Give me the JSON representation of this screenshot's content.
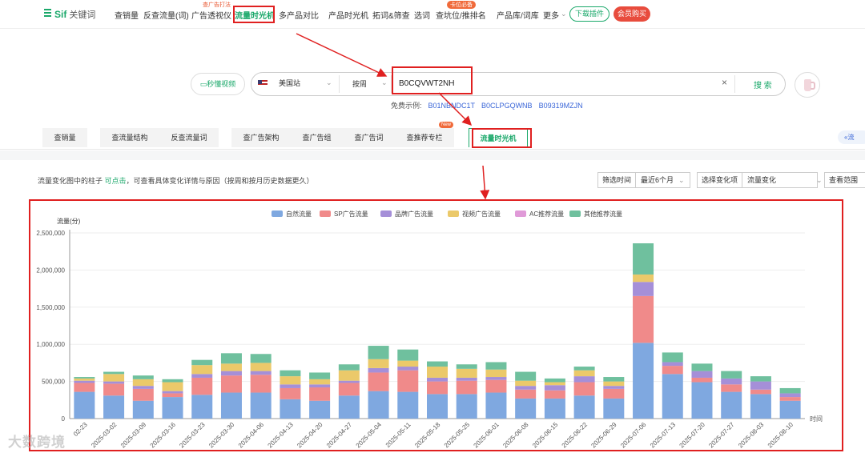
{
  "nav": {
    "logo": "Sif",
    "logo_suffix": "关键词",
    "items": [
      {
        "label": "查销量",
        "x": 143
      },
      {
        "label": "反查流量(词)",
        "x": 179
      },
      {
        "label": "广告透视仪",
        "x": 239
      },
      {
        "label": "流量时光机",
        "x": 293,
        "active": true
      },
      {
        "label": "多产品对比",
        "x": 348
      },
      {
        "label": "产品时光机",
        "x": 410
      },
      {
        "label": "拓词&筛查",
        "x": 465
      },
      {
        "label": "选词",
        "x": 517
      },
      {
        "label": "查坑位/推排名",
        "x": 544
      },
      {
        "label": "产品库/词库",
        "x": 620
      },
      {
        "label": "更多",
        "x": 678
      }
    ],
    "tag_ad": "查广告打法",
    "tag_rank": "卡位必备",
    "download_label": "下载插件",
    "buy_label": "会员购买"
  },
  "search": {
    "video_label": "秒懂视频",
    "site": "美国站",
    "by": "按周",
    "value": "B0CQVWT2NH",
    "search_label": "搜 索",
    "examples_label": "免费示例:",
    "examples": [
      "B01NBNDC1T",
      "B0CLPGQWNB",
      "B09319MZJN"
    ]
  },
  "tabs": [
    {
      "label": "查销量",
      "x": 53,
      "w": 56
    },
    {
      "label": "查流量结构",
      "x": 125,
      "w": 74
    },
    {
      "label": "反查流量词",
      "x": 199,
      "w": 74
    },
    {
      "label": "查广告架构",
      "x": 289,
      "w": 74
    },
    {
      "label": "查广告组",
      "x": 363,
      "w": 65
    },
    {
      "label": "查广告词",
      "x": 428,
      "w": 65
    },
    {
      "label": "查推荐专栏",
      "x": 493,
      "w": 74
    },
    {
      "label": "流量时光机",
      "x": 585,
      "w": 74,
      "active": true
    }
  ],
  "tab_new_badge": "New",
  "collapse_label": "«流",
  "toolbar": {
    "tip_prefix": "流量变化图中的柱子",
    "tip_link": "可点击",
    "tip_suffix": "，可查看具体变化详情与原因（按周和按月历史数据更久）",
    "filter_time_label": "筛选时间",
    "filter_time_value": "最近6个月",
    "change_label": "选择变化项",
    "change_value": "流量变化",
    "range_label": "查看范围"
  },
  "colors": {
    "accent": "#1aa86a",
    "highlight": "#e02020",
    "organic": "#7fa8e0",
    "sp": "#f08a8a",
    "brand": "#a58fd8",
    "video": "#ebc96a",
    "ac": "#e09ad8",
    "other": "#6fc09e"
  },
  "watermark": "大数跨境",
  "chart_data": {
    "type": "bar",
    "stacked": true,
    "ylabel": "流量(分)",
    "xlabel": "时间",
    "ylim": [
      0,
      2500000
    ],
    "yticks": [
      "0",
      "500,000",
      "1,000,000",
      "1,500,000",
      "2,000,000",
      "2,500,000"
    ],
    "categories": [
      "2025-02-23",
      "2025-03-02",
      "2025-03-09",
      "2025-03-16",
      "2025-03-23",
      "2025-03-30",
      "2025-04-06",
      "2025-04-13",
      "2025-04-20",
      "2025-04-27",
      "2025-05-04",
      "2025-05-11",
      "2025-05-18",
      "2025-05-25",
      "2025-06-01",
      "2025-06-08",
      "2025-06-15",
      "2025-06-22",
      "2025-06-29",
      "2025-07-06",
      "2025-07-13",
      "2025-07-20",
      "2025-07-27",
      "2025-08-03",
      "2025-08-10"
    ],
    "tick_labels": [
      "02-23",
      "2025-03-02",
      "2025-03-09",
      "2025-03-16",
      "2025-03-23",
      "2025-03-30",
      "2025-04-06",
      "2025-04-13",
      "2025-04-20",
      "2025-04-27",
      "2025-05-04",
      "2025-05-11",
      "2025-05-18",
      "2025-05-25",
      "2025-06-01",
      "2025-06-08",
      "2025-06-15",
      "2025-06-22",
      "2025-06-29",
      "2025-07-06",
      "2025-07-13",
      "2025-07-20",
      "2025-07-27",
      "2025-08-03",
      "2025-08-10"
    ],
    "legend_position": "top-center",
    "series": [
      {
        "name": "自然流量",
        "color": "#7fa8e0",
        "values": [
          360000,
          310000,
          240000,
          290000,
          320000,
          350000,
          350000,
          260000,
          240000,
          310000,
          370000,
          360000,
          330000,
          330000,
          350000,
          270000,
          270000,
          310000,
          270000,
          1020000,
          600000,
          490000,
          360000,
          330000,
          240000
        ]
      },
      {
        "name": "SP广告流量",
        "color": "#f08a8a",
        "values": [
          120000,
          160000,
          160000,
          50000,
          230000,
          230000,
          240000,
          150000,
          180000,
          170000,
          250000,
          290000,
          170000,
          180000,
          170000,
          120000,
          110000,
          180000,
          130000,
          630000,
          110000,
          60000,
          100000,
          60000,
          50000
        ]
      },
      {
        "name": "品牌广告流量",
        "color": "#a58fd8",
        "values": [
          30000,
          30000,
          40000,
          30000,
          50000,
          60000,
          50000,
          50000,
          40000,
          30000,
          60000,
          50000,
          50000,
          40000,
          40000,
          50000,
          70000,
          80000,
          40000,
          190000,
          50000,
          90000,
          80000,
          110000,
          50000
        ]
      },
      {
        "name": "视频广告流量",
        "color": "#ebc96a",
        "values": [
          30000,
          100000,
          90000,
          120000,
          120000,
          100000,
          110000,
          110000,
          70000,
          140000,
          120000,
          80000,
          150000,
          120000,
          100000,
          70000,
          40000,
          80000,
          60000,
          100000,
          0,
          0,
          0,
          0,
          0
        ]
      },
      {
        "name": "AC推荐流量",
        "color": "#e09ad8",
        "values": [
          0,
          0,
          0,
          0,
          0,
          0,
          0,
          0,
          0,
          0,
          0,
          0,
          0,
          0,
          0,
          0,
          0,
          0,
          0,
          0,
          0,
          0,
          0,
          0,
          0
        ]
      },
      {
        "name": "其他推荐流量",
        "color": "#6fc09e",
        "values": [
          20000,
          30000,
          50000,
          40000,
          70000,
          140000,
          120000,
          80000,
          90000,
          80000,
          180000,
          150000,
          70000,
          60000,
          100000,
          120000,
          50000,
          50000,
          60000,
          420000,
          130000,
          100000,
          100000,
          70000,
          70000
        ]
      }
    ]
  }
}
